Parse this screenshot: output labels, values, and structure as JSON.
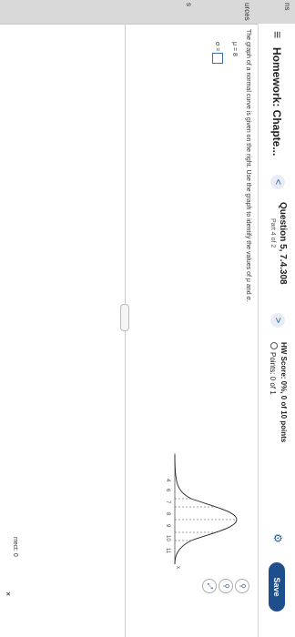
{
  "side": {
    "label1": "ns",
    "label2": "urces",
    "label3": "s"
  },
  "header": {
    "menu_icon": "≡",
    "title": "Homework: Chapte...",
    "question_title": "Question 5, 7.4.308",
    "question_part": "Part 4 of 2",
    "prev_icon": "<",
    "next_icon": ">",
    "hw_score": "HW Score: 0%, 0 of 10 points",
    "points": "Points: 0 of 1",
    "save_label": "Save"
  },
  "question": {
    "text": "The graph of a normal curve is given on the right. Use the graph to identify the values of μ and σ.",
    "mu_label": "μ = 8",
    "sigma_label": "σ ="
  },
  "graph": {
    "x_ticks": [
      "4",
      "6",
      "7",
      "8",
      "9",
      "10",
      "11"
    ],
    "x_label": "x"
  },
  "footer": {
    "correct": "rrect: 0",
    "close_icon": "×"
  },
  "colors": {
    "save_bg": "#1f4e8c",
    "accent": "#3b6fb4"
  }
}
